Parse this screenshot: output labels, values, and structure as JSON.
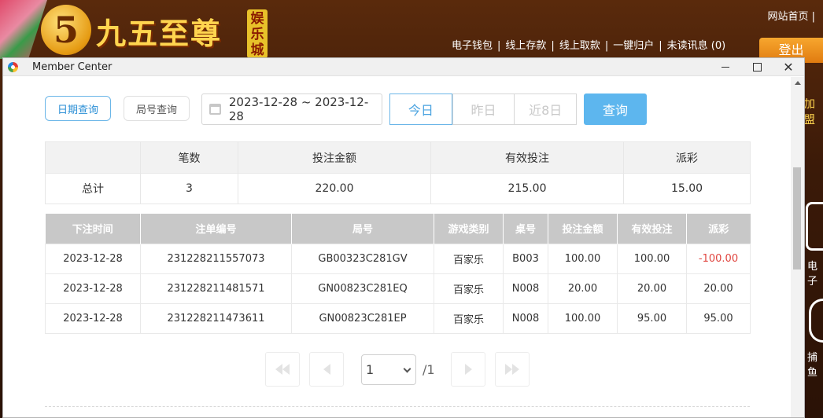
{
  "site": {
    "logo_number": "5",
    "logo_title": "九五至尊",
    "logo_tag": "娱乐城",
    "top_link": "网站首页 |",
    "nav": [
      "电子钱包",
      "线上存款",
      "线上取款",
      "一键归户",
      "未读讯息 (0)"
    ],
    "nav_sep": "|",
    "logout": "登出",
    "side_text": "加盟",
    "side_label_1": "电子",
    "side_label_2": "捕鱼"
  },
  "window": {
    "title": "Member Center",
    "close_glyph": "✕"
  },
  "query": {
    "mode_date": "日期查询",
    "mode_round": "局号查询",
    "date_range": "2023-12-28 ~ 2023-12-28",
    "quick": [
      "今日",
      "昨日",
      "近8日"
    ],
    "submit": "查询"
  },
  "summary": {
    "headers": [
      "",
      "笔数",
      "投注金额",
      "有效投注",
      "派彩"
    ],
    "row": [
      "总计",
      "3",
      "220.00",
      "215.00",
      "15.00"
    ]
  },
  "detail": {
    "headers": [
      "下注时间",
      "注单编号",
      "局号",
      "游戏类别",
      "桌号",
      "投注金额",
      "有效投注",
      "派彩"
    ],
    "rows": [
      [
        "2023-12-28",
        "231228211557073",
        "GB00323C281GV",
        "百家乐",
        "B003",
        "100.00",
        "100.00",
        "-100.00"
      ],
      [
        "2023-12-28",
        "231228211481571",
        "GN00823C281EQ",
        "百家乐",
        "N008",
        "20.00",
        "20.00",
        "20.00"
      ],
      [
        "2023-12-28",
        "231228211473611",
        "GN00823C281EP",
        "百家乐",
        "N008",
        "100.00",
        "95.00",
        "95.00"
      ]
    ]
  },
  "pager": {
    "current": "1",
    "total": "/1"
  },
  "colors": {
    "accent": "#5db6ee",
    "negative": "#e0443e",
    "site_gold": "#ffd54f"
  }
}
